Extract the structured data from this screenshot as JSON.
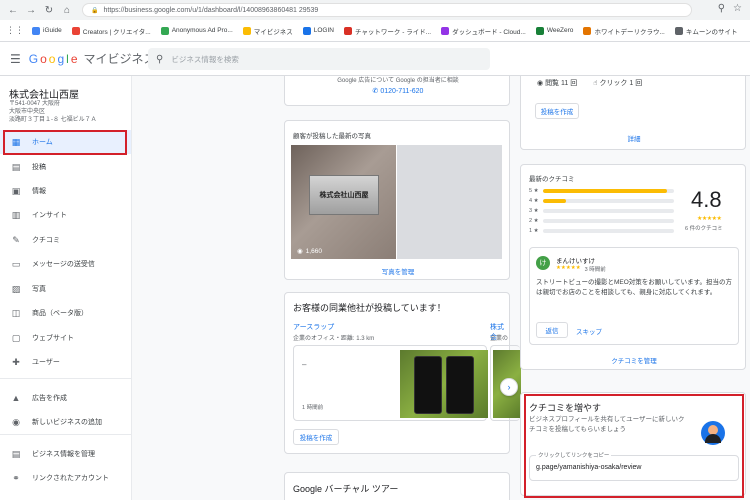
{
  "browser": {
    "url": "https://business.google.com/u/1/dashboard/l/14008963860481 29539",
    "bookmarks": [
      {
        "label": "iGuide",
        "color": "#4285f4"
      },
      {
        "label": "Creators | クリエイタ...",
        "color": "#ea4335"
      },
      {
        "label": "Anonymous Ad Pro...",
        "color": "#34a853"
      },
      {
        "label": "マイビジネス",
        "color": "#fbbc04"
      },
      {
        "label": "LOGIN",
        "color": "#1a73e8"
      },
      {
        "label": "チャットワーク - ライド...",
        "color": "#d93025"
      },
      {
        "label": "ダッシュボード - Cloud...",
        "color": "#9334e6"
      },
      {
        "label": "WeeZero",
        "color": "#188038"
      },
      {
        "label": "ホワイトデーリクラウ...",
        "color": "#e37400"
      },
      {
        "label": "キムーンのサイト",
        "color": "#5f6368"
      }
    ]
  },
  "header": {
    "brand_letters": [
      "G",
      "o",
      "o",
      "g",
      "l",
      "e"
    ],
    "product": "マイビジネス",
    "search_placeholder": "ビジネス情報を検索"
  },
  "sidebar": {
    "business_name": "株式会社山西屋",
    "address_lines": [
      "〒541-0047 大阪府",
      "大阪市中央区",
      "淡路町３丁目１-８ 七福ビル７Ａ"
    ],
    "items": [
      {
        "label": "ホーム",
        "icon": "home-icon",
        "glyph": "▦",
        "active": true
      },
      {
        "label": "投稿",
        "icon": "posts-icon",
        "glyph": "▤"
      },
      {
        "label": "情報",
        "icon": "info-icon",
        "glyph": "▣"
      },
      {
        "label": "インサイト",
        "icon": "insights-icon",
        "glyph": "▥"
      },
      {
        "label": "クチコミ",
        "icon": "reviews-icon",
        "glyph": "✎"
      },
      {
        "label": "メッセージの送受信",
        "icon": "messages-icon",
        "glyph": "▭"
      },
      {
        "label": "写真",
        "icon": "photos-icon",
        "glyph": "▨"
      },
      {
        "label": "商品（ベータ版）",
        "icon": "products-icon",
        "glyph": "◫"
      },
      {
        "label": "ウェブサイト",
        "icon": "website-icon",
        "glyph": "▢"
      },
      {
        "label": "ユーザー",
        "icon": "users-icon",
        "glyph": "✚"
      },
      {
        "label": "広告を作成",
        "icon": "ads-icon",
        "glyph": "▲"
      },
      {
        "label": "新しいビジネスの追加",
        "icon": "add-location-icon",
        "glyph": "◉"
      },
      {
        "label": "ビジネス情報を管理",
        "icon": "manage-icon",
        "glyph": "▤"
      },
      {
        "label": "リンクされたアカウント",
        "icon": "link-icon",
        "glyph": "⚭"
      }
    ]
  },
  "ads_card": {
    "notice": "Google 広告について Google の担当者に相談",
    "phone": "0120-711-620"
  },
  "photos_card": {
    "title": "顧客が投稿した最新の写真",
    "plaque_text": "株式会社山西屋",
    "view_count": "1,660",
    "manage_link": "写真を管理"
  },
  "competitors_card": {
    "title": "お客様の同業他社が投稿しています！",
    "competitor_name": "アースラップ",
    "competitor_meta": "企業のオフィス・距離: 1.3 km",
    "post_dash": "–",
    "post_time": "1 時間前",
    "next_competitor": "株式会",
    "next_meta": "企業の",
    "create_post": "投稿を作成"
  },
  "virtual_tour_card": {
    "title": "Google バーチャル ツアー"
  },
  "right_top_card": {
    "views": "閲覧 11 回",
    "clicks": "クリック 1 回",
    "create_post": "投稿を作成",
    "details": "詳細"
  },
  "reviews_card": {
    "title": "最新のクチコミ",
    "rows": [
      {
        "label": "5 ★",
        "fraction": 0.95
      },
      {
        "label": "4 ★",
        "fraction": 0.18
      },
      {
        "label": "3 ★",
        "fraction": 0
      },
      {
        "label": "2 ★",
        "fraction": 0
      },
      {
        "label": "1 ★",
        "fraction": 0
      }
    ],
    "score": "4.8",
    "stars": "★★★★★",
    "count": "6 件のクチコミ",
    "reviewer_initial": "け",
    "reviewer_name": "まんけいすけ",
    "review_stars": "★★★★★",
    "review_time": "3 時間前",
    "review_text": "ストリートビューの撮影とMEO対策をお願いしています。担当の方は親切でお店のことを相談しても、親身に対応してくれます。",
    "reply_button": "返信",
    "skip_button": "スキップ",
    "manage_link": "クチコミを管理"
  },
  "increase_reviews_card": {
    "title": "クチコミを増やす",
    "desc": "ビジネスプロフィールを共有してユーザーに新しいクチコミを投稿してもらいましょう",
    "copy_label": "クリックしてリンクをコピー",
    "link": "g.page/yamanishiya-osaka/review"
  },
  "colors": {
    "highlight": "#d3202a",
    "accent": "#1a73e8",
    "star": "#fbbc04"
  }
}
